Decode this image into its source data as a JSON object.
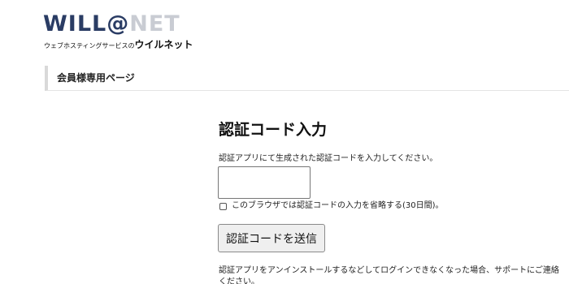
{
  "brand": {
    "logo_part1": "WILL",
    "logo_at": "@",
    "logo_part2": "NET",
    "tagline_small": "ウェブホスティングサービスの",
    "tagline_big": "ウイルネット",
    "colors": {
      "primary": "#2a3c64",
      "secondary": "#c9ccd3"
    }
  },
  "header": {
    "section_title": "会員様専用ページ"
  },
  "auth_form": {
    "title": "認証コード入力",
    "instruction": "認証アプリにて生成された認証コードを入力してください。",
    "code_input": {
      "value": "",
      "placeholder": ""
    },
    "remember_label": "このブラウザでは認証コードの入力を省略する(30日間)。",
    "remember_checked": false,
    "submit_label": "認証コードを送信",
    "support_note": "認証アプリをアンインストールするなどしてログインできなくなった場合、サポートにご連絡ください。"
  }
}
